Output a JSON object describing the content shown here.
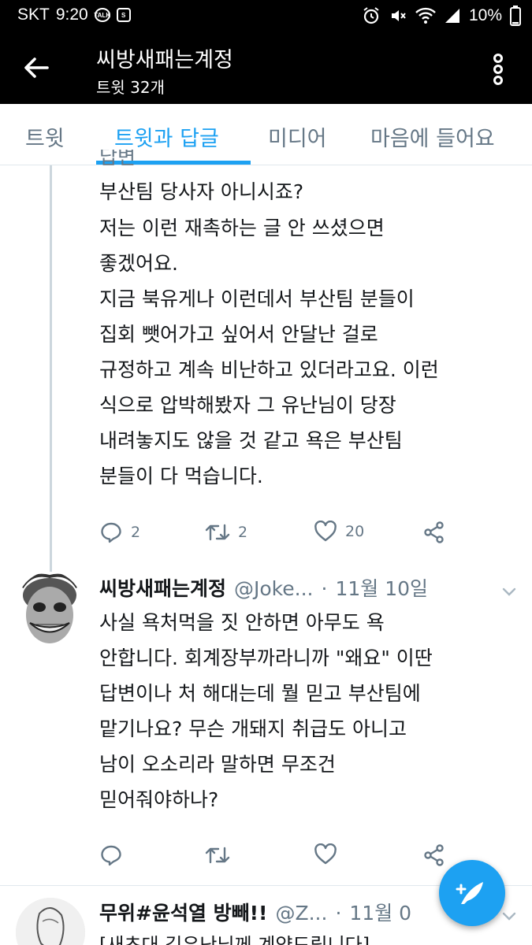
{
  "status_bar": {
    "carrier": "SKT",
    "time": "9:20",
    "talk_badge": "TALK",
    "s_badge": "S",
    "battery": "10%"
  },
  "app_bar": {
    "title": "씨방새패는계정",
    "subtitle": "트윗 32개"
  },
  "tabs": [
    {
      "label": "트윗"
    },
    {
      "label": "트윗과 답글"
    },
    {
      "label": "미디어"
    },
    {
      "label": "마음에 들어요"
    }
  ],
  "tweet1": {
    "clipped_top": "답변",
    "lines": [
      "부산팀 당사자 아니시죠?",
      "저는 이런 재촉하는 글 안 쓰셨으면",
      "좋겠어요.",
      "지금 북유게나 이런데서 부산팀 분들이",
      "집회 뺏어가고 싶어서 안달난 걸로",
      "규정하고 계속 비난하고 있더라고요. 이런",
      "식으로 압박해봤자 그 유난님이 당장",
      "내려놓지도 않을 것 같고 욕은 부산팀",
      "분들이 다 먹습니다."
    ],
    "replies": "2",
    "retweets": "2",
    "likes": "20"
  },
  "tweet2": {
    "name": "씨방새패는계정",
    "handle": "@Joke...",
    "separator": "·",
    "date": "11월 10일",
    "lines": [
      "사실 욕처먹을 짓 안하면 아무도 욕",
      "안합니다. 회계장부까라니까 \"왜요\" 이딴",
      "답변이나 처 해대는데 뭘 믿고 부산팀에",
      "맡기나요? 무슨 개돼지 취급도 아니고",
      "남이 오소리라 말하면 무조건",
      "믿어줘야하나?"
    ]
  },
  "tweet3": {
    "name": "무위#윤석열 방빼!!",
    "handle": "@Z...",
    "separator": "·",
    "date": "11월 0",
    "first_line": "[새초대 김유난님께 계약드립니다]"
  },
  "colors": {
    "accent": "#1da1f2",
    "muted": "#657786",
    "text": "#14171a"
  }
}
